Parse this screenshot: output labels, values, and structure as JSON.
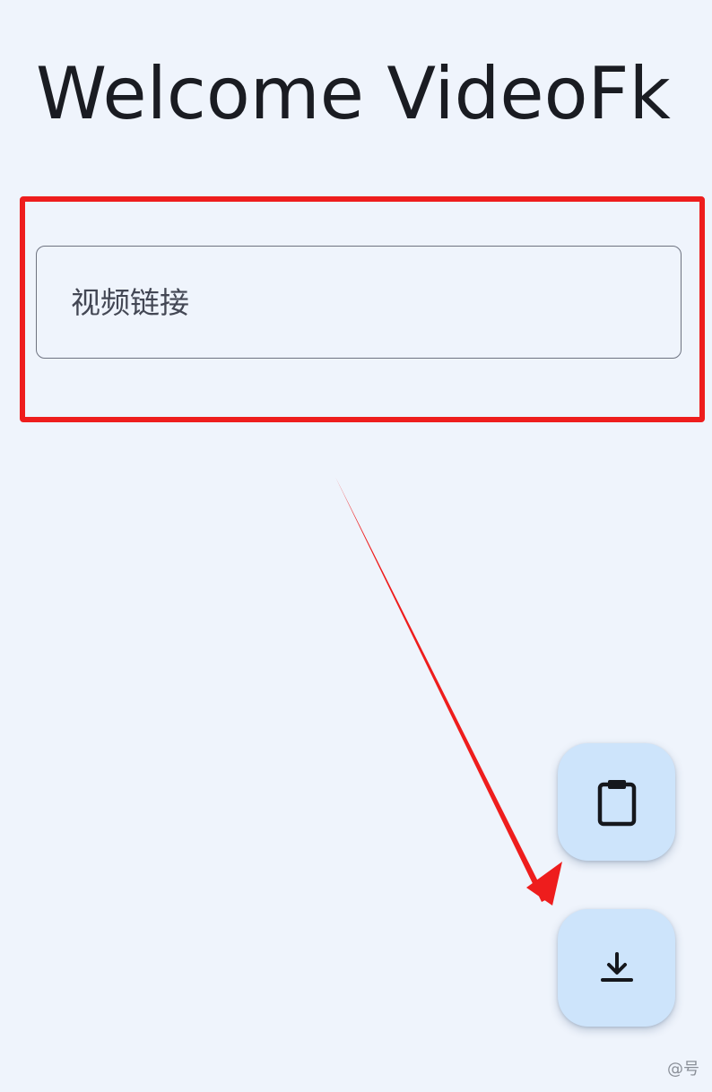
{
  "app": {
    "title": "Welcome VideoFk"
  },
  "input": {
    "placeholder": "视频链接",
    "value": ""
  },
  "actions": {
    "paste_icon": "clipboard-icon",
    "download_icon": "download-icon"
  },
  "watermark": {
    "text": "@号"
  },
  "colors": {
    "background": "#eff4fc",
    "annotation_red": "#ee1d1d",
    "fab_background": "#cde4fb",
    "title_text": "#1a1c22"
  }
}
